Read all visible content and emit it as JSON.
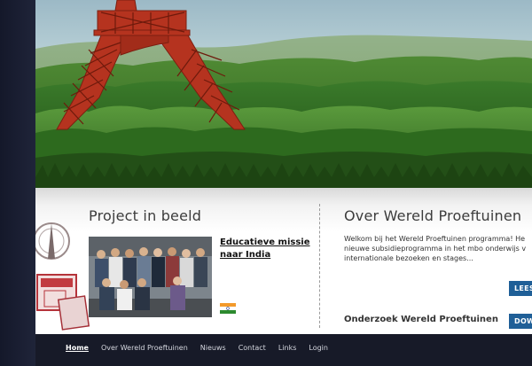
{
  "project": {
    "heading": "Project in beeld",
    "link_line1": "Educatieve missie",
    "link_line2": "naar India",
    "flag_icon": "india-flag-icon"
  },
  "about": {
    "heading": "Over Wereld Proeftuinen",
    "text_lines": [
      "Welkom bij het Wereld Proeftuinen programma! He",
      "nieuwe subsidieprogramma in het mbo onderwijs v",
      "internationale bezoeken en stages..."
    ],
    "read_button": "LEES",
    "research_heading": "Onderzoek Wereld Proeftuinen",
    "download_button": "DOW"
  },
  "footer": {
    "nav": [
      {
        "label": "Home",
        "active": true
      },
      {
        "label": "Over Wereld Proeftuinen",
        "active": false
      },
      {
        "label": "Nieuws",
        "active": false
      },
      {
        "label": "Contact",
        "active": false
      },
      {
        "label": "Links",
        "active": false
      },
      {
        "label": "Login",
        "active": false
      }
    ]
  },
  "colors": {
    "button_blue": "#1f5f97",
    "tower_red": "#b5331f",
    "footer_bg": "#171a28"
  }
}
